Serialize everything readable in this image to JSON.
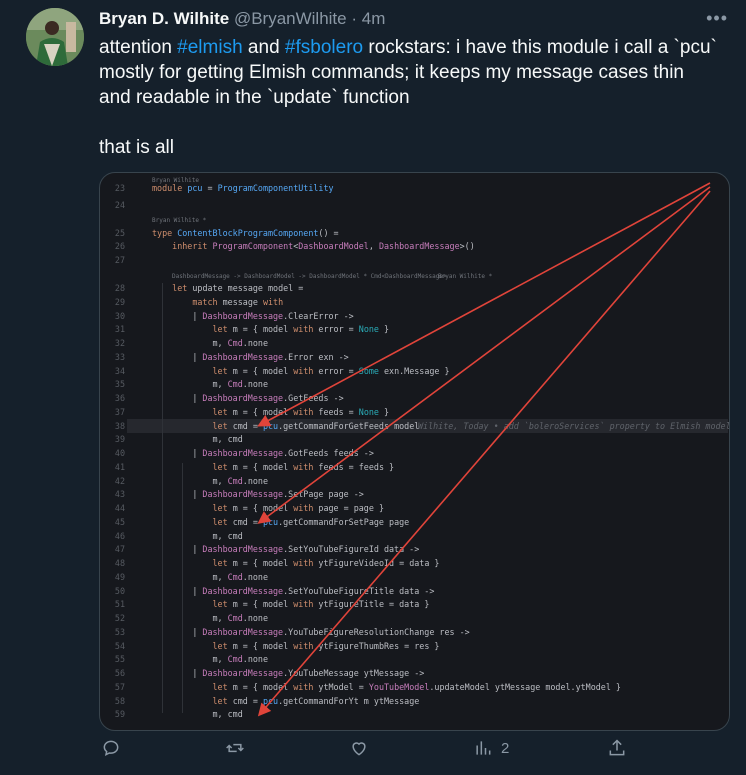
{
  "author": {
    "name": "Bryan D. Wilhite",
    "handle": "@BryanWilhite",
    "separator": "·",
    "time": "4m"
  },
  "more_label": "•••",
  "tweet": {
    "line1_pre": "attention ",
    "tag1": "#elmish",
    "line1_mid": " and ",
    "tag2": "#fsbolero",
    "line1_post": " rockstars: i have this module i call a `pcu` mostly for getting Elmish commands; it keeps my message cases thin and readable in the `update` function",
    "line2": "that is all"
  },
  "code": {
    "author_top": "Bryan Wilhite",
    "author_mid": "Bryan Wilhite *",
    "inlay_hint": "DashboardMessage -> DashboardModel -> DashboardModel * Cmd<DashboardMessage>",
    "author_hint": "Bryan Wilhite *",
    "blame": "Wilhite, Today • add `boleroServices` property to Elmish model",
    "lines": [
      {
        "n": "23",
        "t": "module pcu = ProgramComponentUtility"
      },
      {
        "n": "24",
        "t": ""
      },
      {
        "n": "25",
        "t": "type ContentBlockProgramComponent() ="
      },
      {
        "n": "26",
        "t": "    inherit ProgramComponent<DashboardModel, DashboardMessage>()"
      },
      {
        "n": "27",
        "t": ""
      },
      {
        "n": "28",
        "t": "    let update message model ="
      },
      {
        "n": "29",
        "t": "        match message with"
      },
      {
        "n": "30",
        "t": "        | DashboardMessage.ClearError ->"
      },
      {
        "n": "31",
        "t": "            let m = { model with error = None }"
      },
      {
        "n": "32",
        "t": "            m, Cmd.none"
      },
      {
        "n": "33",
        "t": "        | DashboardMessage.Error exn ->"
      },
      {
        "n": "34",
        "t": "            let m = { model with error = Some exn.Message }"
      },
      {
        "n": "35",
        "t": "            m, Cmd.none"
      },
      {
        "n": "36",
        "t": "        | DashboardMessage.GetFeeds ->"
      },
      {
        "n": "37",
        "t": "            let m = { model with feeds = None }"
      },
      {
        "n": "38",
        "t": "            let cmd = pcu.getCommandForGetFeeds model"
      },
      {
        "n": "39",
        "t": "            m, cmd"
      },
      {
        "n": "40",
        "t": "        | DashboardMessage.GotFeeds feeds ->"
      },
      {
        "n": "41",
        "t": "            let m = { model with feeds = feeds }"
      },
      {
        "n": "42",
        "t": "            m, Cmd.none"
      },
      {
        "n": "43",
        "t": "        | DashboardMessage.SetPage page ->"
      },
      {
        "n": "44",
        "t": "            let m = { model with page = page }"
      },
      {
        "n": "45",
        "t": "            let cmd = pcu.getCommandForSetPage page"
      },
      {
        "n": "46",
        "t": "            m, cmd"
      },
      {
        "n": "47",
        "t": "        | DashboardMessage.SetYouTubeFigureId data ->"
      },
      {
        "n": "48",
        "t": "            let m = { model with ytFigureVideoId = data }"
      },
      {
        "n": "49",
        "t": "            m, Cmd.none"
      },
      {
        "n": "50",
        "t": "        | DashboardMessage.SetYouTubeFigureTitle data ->"
      },
      {
        "n": "51",
        "t": "            let m = { model with ytFigureTitle = data }"
      },
      {
        "n": "52",
        "t": "            m, Cmd.none"
      },
      {
        "n": "53",
        "t": "        | DashboardMessage.YouTubeFigureResolutionChange res ->"
      },
      {
        "n": "54",
        "t": "            let m = { model with ytFigureThumbRes = res }"
      },
      {
        "n": "55",
        "t": "            m, Cmd.none"
      },
      {
        "n": "56",
        "t": "        | DashboardMessage.YouTubeMessage ytMessage ->"
      },
      {
        "n": "57",
        "t": "            let m = { model with ytModel = YouTubeModel.updateModel ytMessage model.ytModel }"
      },
      {
        "n": "58",
        "t": "            let cmd = pcu.getCommandForYt m ytMessage"
      },
      {
        "n": "59",
        "t": "            m, cmd"
      }
    ]
  },
  "actions": {
    "reply_icon": "reply-icon",
    "retweet_icon": "retweet-icon",
    "like_icon": "heart-icon",
    "views_icon": "views-icon",
    "views_count": "2",
    "share_icon": "share-icon"
  },
  "colors": {
    "background": "#15202b",
    "link": "#1d9bf0",
    "muted": "#8b98a5",
    "code_bg": "#16181d",
    "arrow": "#e0443a"
  }
}
